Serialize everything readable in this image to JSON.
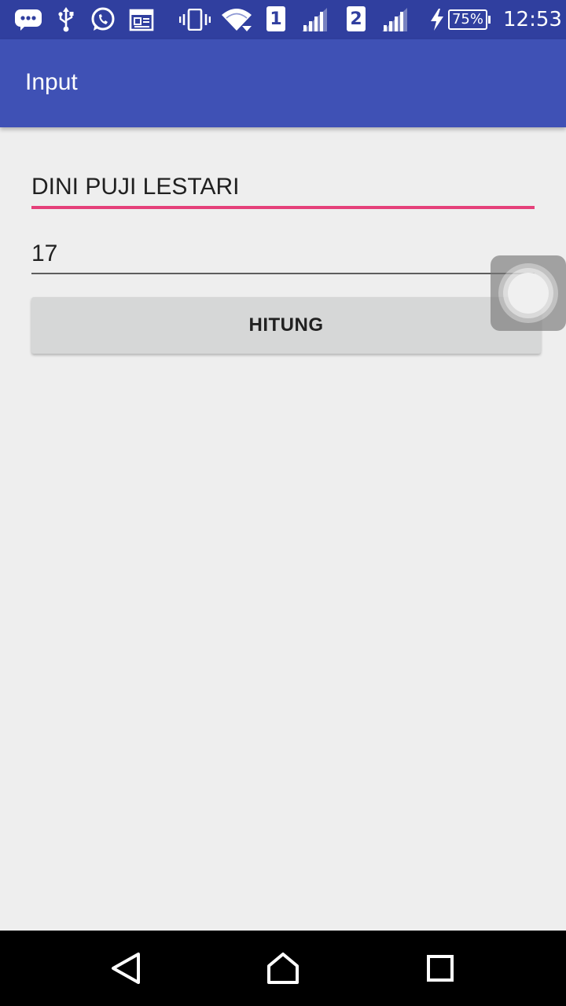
{
  "status_bar": {
    "icons": [
      "messenger-icon",
      "usb-icon",
      "whatsapp-icon",
      "calendar-icon",
      "vibrate-icon",
      "wifi-icon",
      "sim1-signal-icon",
      "sim2-signal-icon",
      "charging-icon",
      "battery-icon"
    ],
    "sim1_label": "1",
    "sim2_label": "2",
    "battery_label": "75%",
    "time": "12:53"
  },
  "app_bar": {
    "title": "Input",
    "color": "#3F51B5",
    "status_color": "#303F9F"
  },
  "form": {
    "name_value": "DINI PUJI LESTARI",
    "age_value": "17",
    "accent_color": "#E5407A",
    "submit_label": "HITUNG"
  },
  "nav_bar": {
    "icons": [
      "back-icon",
      "home-icon",
      "recents-icon"
    ]
  }
}
